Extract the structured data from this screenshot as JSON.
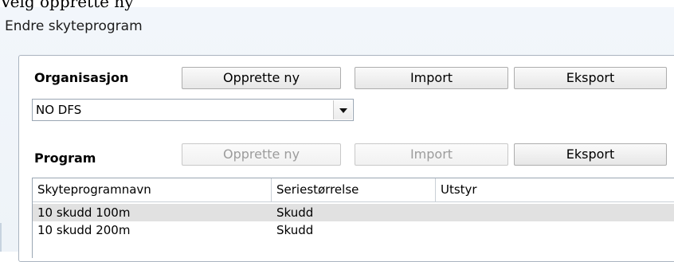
{
  "page_caption": "Velg opprette ny",
  "window": {
    "title": "Endre skyteprogram"
  },
  "organisation": {
    "label": "Organisasjon",
    "buttons": {
      "create": "Opprette ny",
      "import": "Import",
      "export": "Eksport"
    },
    "selected_value": "NO DFS"
  },
  "program": {
    "label": "Program",
    "buttons": {
      "create": "Opprette ny",
      "import": "Import",
      "export": "Eksport"
    },
    "columns": [
      "Skyteprogramnavn",
      "Seriestørrelse",
      "Utstyr"
    ],
    "rows": [
      {
        "name": "10 skudd 100m",
        "series": "Skudd",
        "equipment": ""
      },
      {
        "name": "10 skudd 200m",
        "series": "Skudd",
        "equipment": ""
      }
    ]
  }
}
